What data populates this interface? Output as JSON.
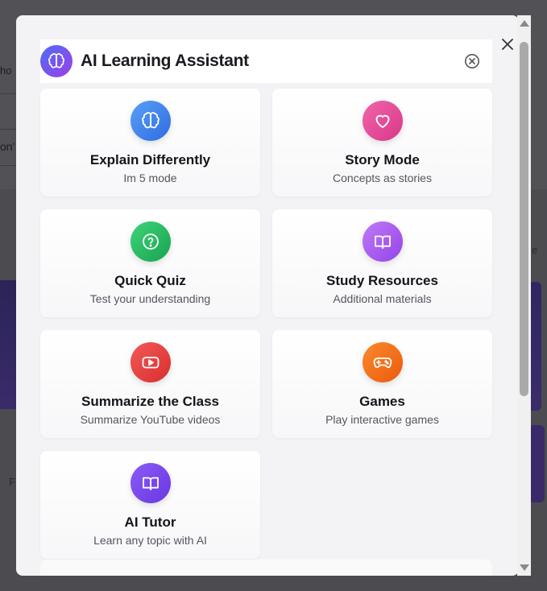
{
  "modal": {
    "title": "AI Learning Assistant"
  },
  "background": {
    "frag1": "ho",
    "frag2": "on'",
    "frag3": "e",
    "frag4": "F"
  },
  "cards": [
    {
      "title": "Explain Differently",
      "subtitle": "Im 5 mode",
      "icon": "brain-icon",
      "color_from": "#5aa0f7",
      "color_to": "#2f6be0"
    },
    {
      "title": "Story Mode",
      "subtitle": "Concepts as stories",
      "icon": "heart-icon",
      "color_from": "#f066a8",
      "color_to": "#d9378a"
    },
    {
      "title": "Quick Quiz",
      "subtitle": "Test your understanding",
      "icon": "question-circle-icon",
      "color_from": "#3fd47a",
      "color_to": "#17a34f"
    },
    {
      "title": "Study Resources",
      "subtitle": "Additional materials",
      "icon": "book-open-icon",
      "color_from": "#c07af7",
      "color_to": "#9344e6"
    },
    {
      "title": "Summarize the Class",
      "subtitle": "Summarize YouTube videos",
      "icon": "youtube-icon",
      "color_from": "#f25a5a",
      "color_to": "#d92d2d"
    },
    {
      "title": "Games",
      "subtitle": "Play interactive games",
      "icon": "gamepad-icon",
      "color_from": "#fb8a2e",
      "color_to": "#ea5a0c"
    },
    {
      "title": "AI Tutor",
      "subtitle": "Learn any topic with AI",
      "icon": "book-open-icon",
      "color_from": "#8a5cf6",
      "color_to": "#6a36e2"
    }
  ]
}
